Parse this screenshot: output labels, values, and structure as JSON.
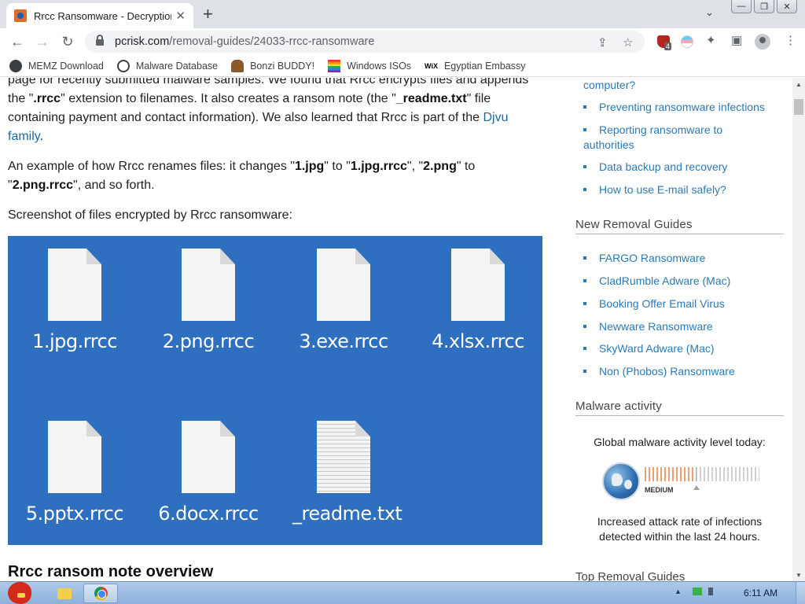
{
  "browser": {
    "tab_title": "Rrcc Ransomware - Decryption",
    "tab_close": "✕",
    "new_tab": "+",
    "tab_search": "⌄",
    "window_controls": [
      "—",
      "❐",
      "✕"
    ],
    "url_host": "pcrisk.com",
    "url_path": "/removal-guides/24033-rrcc-ransomware",
    "extension_badge": "4",
    "bookmarks": [
      {
        "label": "MEMZ Download",
        "icon": "memz-icon"
      },
      {
        "label": "Malware Database",
        "icon": "globe-icon"
      },
      {
        "label": "Bonzi BUDDY!",
        "icon": "bonzi-icon"
      },
      {
        "label": "Windows ISOs",
        "icon": "windows-flag-icon"
      },
      {
        "label": "Egyptian Embassy",
        "icon": "wix-icon",
        "icon_text": "WiX"
      }
    ]
  },
  "article": {
    "p1_line0": "page for recently submitted malware samples. We found that Rrcc encrypts files and appends",
    "p1_a": "the \"",
    "p1_ext": ".rrcc",
    "p1_b": "\" extension to filenames. It also creates a ransom note (the \"",
    "p1_note": "_readme.txt",
    "p1_c": "\" file containing payment and contact information). We also learned that Rrcc is part of the ",
    "p1_link": "Djvu family",
    "p1_d": ".",
    "p2_a": "An example of how Rrcc renames files: it changes \"",
    "p2_f1": "1.jpg",
    "p2_b": "\" to \"",
    "p2_f2": "1.jpg.rrcc",
    "p2_c": "\", \"",
    "p2_f3": "2.png",
    "p2_d": "\" to \"",
    "p2_f4": "2.png.rrcc",
    "p2_e": "\", and so forth.",
    "p3": "Screenshot of files encrypted by Rrcc ransomware:",
    "files": [
      "1.jpg.rrcc",
      "2.png.rrcc",
      "3.exe.rrcc",
      "4.xlsx.rrcc",
      "5.pptx.rrcc",
      "6.docx.rrcc",
      "_readme.txt"
    ],
    "heading": "Rrcc ransom note overview"
  },
  "sidebar": {
    "top_links": [
      {
        "label": "computer?",
        "bullet": false
      },
      {
        "label": "Preventing ransomware infections",
        "bullet": true
      },
      {
        "label": "Reporting ransomware to",
        "label2": "authorities",
        "bullet": true
      },
      {
        "label": "Data backup and recovery",
        "bullet": true
      },
      {
        "label": "How to use E-mail safely?",
        "bullet": true
      }
    ],
    "new_guides_heading": "New Removal Guides",
    "new_guides": [
      "FARGO Ransomware",
      "CladRumble Adware (Mac)",
      "Booking Offer Email Virus",
      "Newware Ransomware",
      "SkyWard Adware (Mac)",
      "Non (Phobos) Ransomware"
    ],
    "activity_heading": "Malware activity",
    "activity_title": "Global malware activity level today:",
    "activity_level_label": "MEDIUM",
    "activity_level_fraction": 0.45,
    "activity_desc_1": "Increased attack rate of infections",
    "activity_desc_2": "detected within the last 24 hours.",
    "top_guides_heading": "Top Removal Guides"
  },
  "taskbar": {
    "clock": "6:11 AM",
    "tray_arrow": "▲"
  },
  "colors": {
    "link": "#2a7ab5",
    "screenshot_bg": "#2e6fc0"
  }
}
